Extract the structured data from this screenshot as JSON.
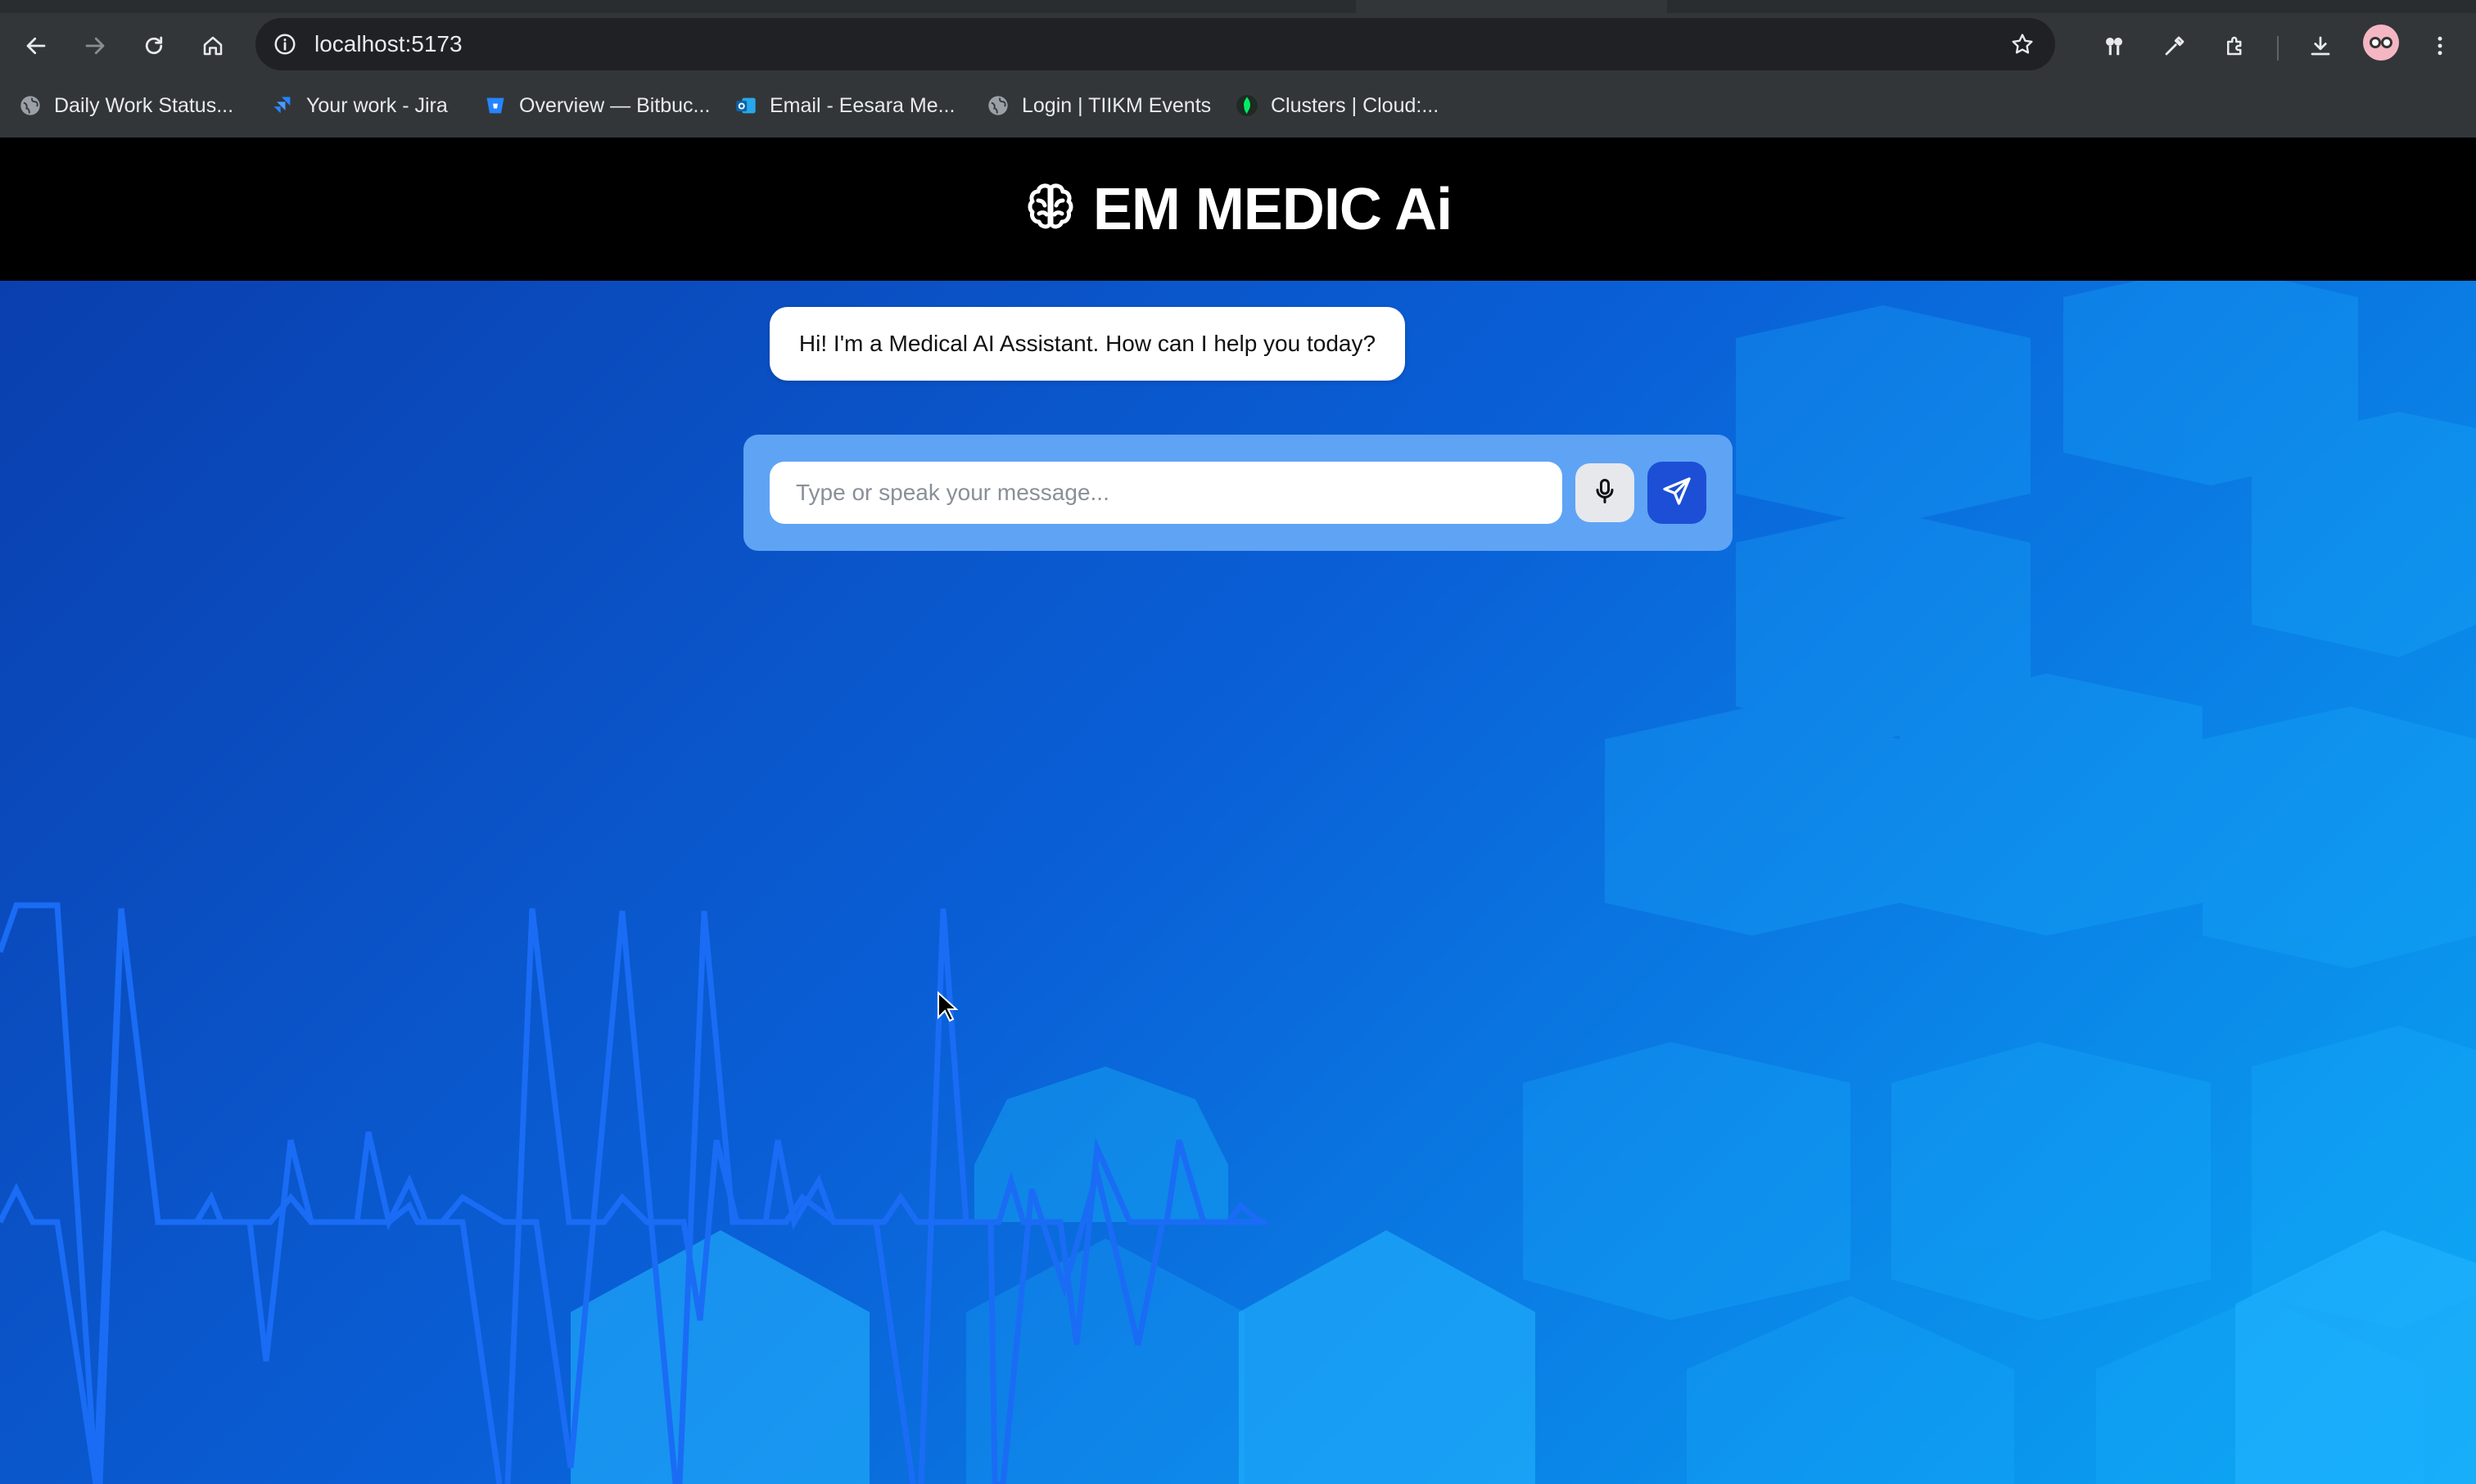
{
  "browser": {
    "url": "localhost:5173",
    "nav_icons": [
      "back-icon",
      "forward-icon",
      "reload-icon",
      "home-icon"
    ],
    "bookmarks": [
      {
        "label": "Daily Work Status...",
        "icon": "globe-icon"
      },
      {
        "label": "Your work - Jira",
        "icon": "jira-icon"
      },
      {
        "label": "Overview — Bitbuc...",
        "icon": "bitbucket-icon"
      },
      {
        "label": "Email - Eesara Me...",
        "icon": "outlook-icon"
      },
      {
        "label": "Login | TIIKM Events",
        "icon": "globe-icon"
      },
      {
        "label": "Clusters | Cloud:...",
        "icon": "mongodb-leaf-icon"
      }
    ]
  },
  "app": {
    "title": "EM MEDIC Ai",
    "logo_icon": "brain-icon",
    "greeting": "Hi! I'm a Medical AI Assistant. How can I help you today?",
    "input": {
      "placeholder": "Type or speak your message...",
      "value": ""
    },
    "mic_icon": "microphone-icon",
    "send_icon": "send-icon"
  },
  "colors": {
    "header_bg": "#000000",
    "composer_bg": "#5fa3f5",
    "send_button": "#1c4fd6",
    "ecg_line": "#1a6cf5"
  }
}
